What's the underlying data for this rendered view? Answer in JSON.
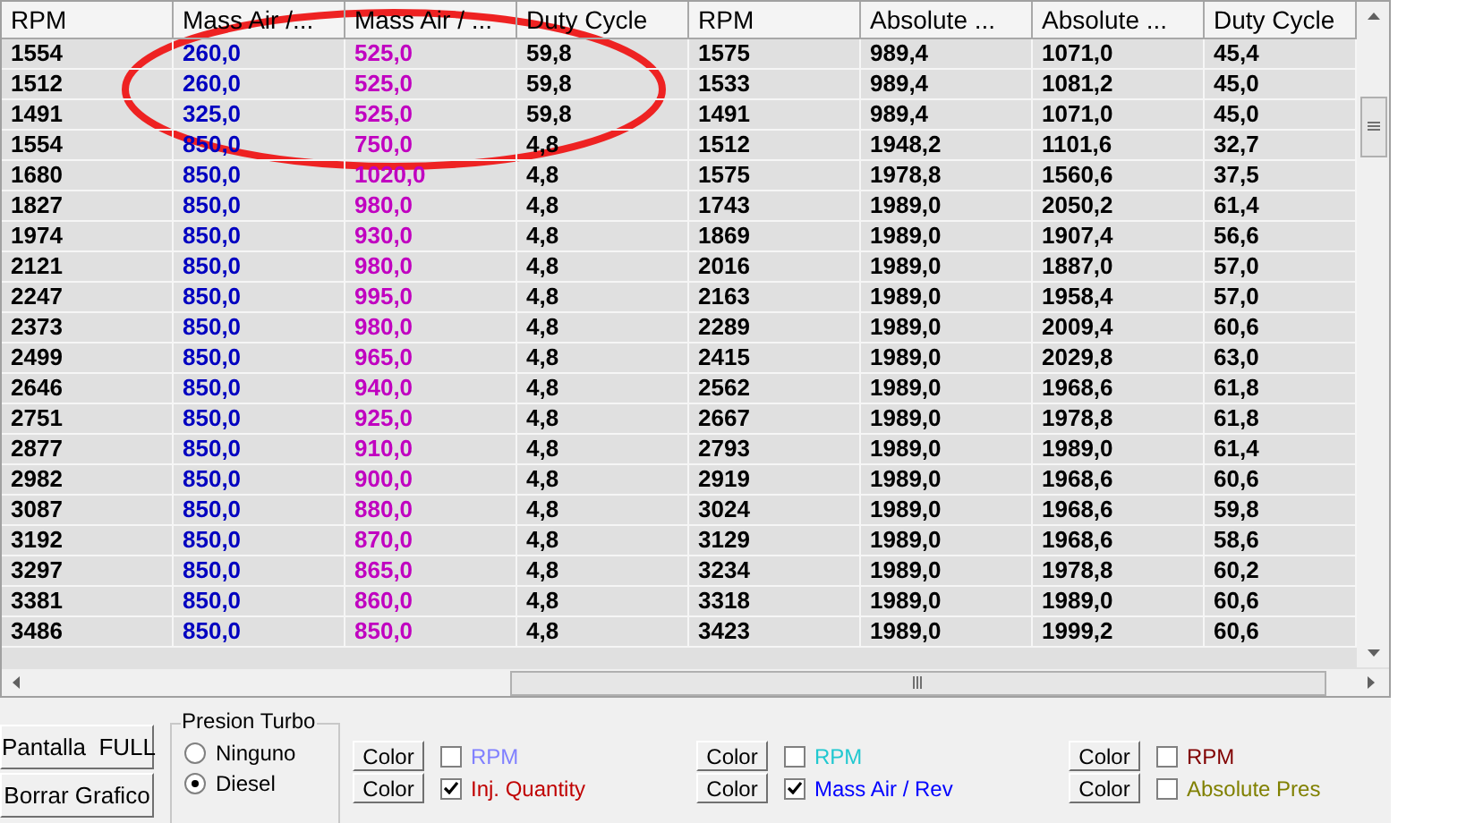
{
  "table": {
    "columns": [
      {
        "label": "RPM",
        "color": "#000000"
      },
      {
        "label": "Mass Air /...",
        "color": "#0000c0"
      },
      {
        "label": "Mass Air / ...",
        "color": "#c000c0"
      },
      {
        "label": "Duty Cycle",
        "color": "#000000"
      },
      {
        "label": "RPM",
        "color": "#000000"
      },
      {
        "label": "Absolute ...",
        "color": "#000000"
      },
      {
        "label": "Absolute ...",
        "color": "#000000"
      },
      {
        "label": "Duty Cycle",
        "color": "#000000"
      }
    ],
    "rows": [
      [
        "1554",
        "260,0",
        "525,0",
        "59,8",
        "1575",
        "989,4",
        "1071,0",
        "45,4"
      ],
      [
        "1512",
        "260,0",
        "525,0",
        "59,8",
        "1533",
        "989,4",
        "1081,2",
        "45,0"
      ],
      [
        "1491",
        "325,0",
        "525,0",
        "59,8",
        "1491",
        "989,4",
        "1071,0",
        "45,0"
      ],
      [
        "1554",
        "850,0",
        "750,0",
        "4,8",
        "1512",
        "1948,2",
        "1101,6",
        "32,7"
      ],
      [
        "1680",
        "850,0",
        "1020,0",
        "4,8",
        "1575",
        "1978,8",
        "1560,6",
        "37,5"
      ],
      [
        "1827",
        "850,0",
        "980,0",
        "4,8",
        "1743",
        "1989,0",
        "2050,2",
        "61,4"
      ],
      [
        "1974",
        "850,0",
        "930,0",
        "4,8",
        "1869",
        "1989,0",
        "1907,4",
        "56,6"
      ],
      [
        "2121",
        "850,0",
        "980,0",
        "4,8",
        "2016",
        "1989,0",
        "1887,0",
        "57,0"
      ],
      [
        "2247",
        "850,0",
        "995,0",
        "4,8",
        "2163",
        "1989,0",
        "1958,4",
        "57,0"
      ],
      [
        "2373",
        "850,0",
        "980,0",
        "4,8",
        "2289",
        "1989,0",
        "2009,4",
        "60,6"
      ],
      [
        "2499",
        "850,0",
        "965,0",
        "4,8",
        "2415",
        "1989,0",
        "2029,8",
        "63,0"
      ],
      [
        "2646",
        "850,0",
        "940,0",
        "4,8",
        "2562",
        "1989,0",
        "1968,6",
        "61,8"
      ],
      [
        "2751",
        "850,0",
        "925,0",
        "4,8",
        "2667",
        "1989,0",
        "1978,8",
        "61,8"
      ],
      [
        "2877",
        "850,0",
        "910,0",
        "4,8",
        "2793",
        "1989,0",
        "1989,0",
        "61,4"
      ],
      [
        "2982",
        "850,0",
        "900,0",
        "4,8",
        "2919",
        "1989,0",
        "1968,6",
        "60,6"
      ],
      [
        "3087",
        "850,0",
        "880,0",
        "4,8",
        "3024",
        "1989,0",
        "1968,6",
        "59,8"
      ],
      [
        "3192",
        "850,0",
        "870,0",
        "4,8",
        "3129",
        "1989,0",
        "1968,6",
        "58,6"
      ],
      [
        "3297",
        "850,0",
        "865,0",
        "4,8",
        "3234",
        "1989,0",
        "1978,8",
        "60,2"
      ],
      [
        "3381",
        "850,0",
        "860,0",
        "4,8",
        "3318",
        "1989,0",
        "1989,0",
        "60,6"
      ],
      [
        "3486",
        "850,0",
        "850,0",
        "4,8",
        "3423",
        "1989,0",
        "1999,2",
        "60,6"
      ]
    ]
  },
  "buttons": [
    "Pantalla  FULL",
    "Borrar Grafico"
  ],
  "presion_turbo": {
    "title": "Presion Turbo",
    "options": [
      {
        "label": "Ninguno",
        "selected": false
      },
      {
        "label": "Diesel",
        "selected": true
      }
    ]
  },
  "series_groups": [
    [
      {
        "button": "Color",
        "label": "RPM",
        "checked": false,
        "color": "#8080ff"
      },
      {
        "button": "Color",
        "label": "Inj. Quantity",
        "checked": true,
        "color": "#c00000"
      }
    ],
    [
      {
        "button": "Color",
        "label": "RPM",
        "checked": false,
        "color": "#20c8d0"
      },
      {
        "button": "Color",
        "label": "Mass Air / Rev",
        "checked": true,
        "color": "#0000ff"
      }
    ],
    [
      {
        "button": "Color",
        "label": "RPM",
        "checked": false,
        "color": "#800000"
      },
      {
        "button": "Color",
        "label": "Absolute Pres",
        "checked": false,
        "color": "#808000"
      }
    ]
  ]
}
